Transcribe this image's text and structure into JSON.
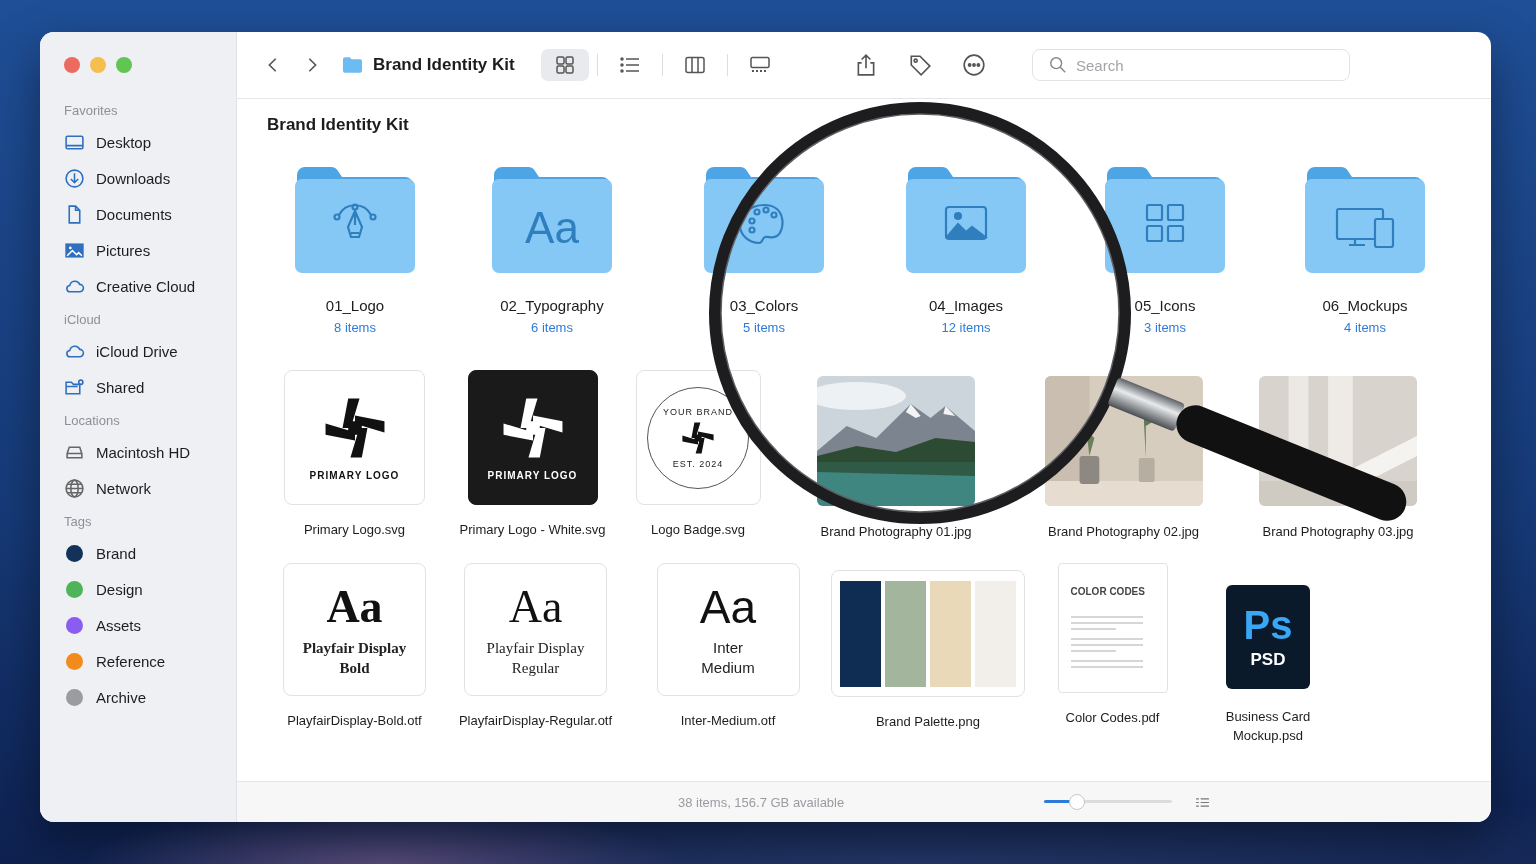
{
  "toolbar": {
    "title": "Brand Identity Kit",
    "views": [
      {
        "kind": "icons",
        "selected": true
      },
      {
        "kind": "list",
        "selected": false
      },
      {
        "kind": "columns",
        "selected": false
      },
      {
        "kind": "gallery",
        "selected": false
      }
    ],
    "actions": [
      {
        "kind": "share"
      },
      {
        "kind": "tag"
      },
      {
        "kind": "more"
      }
    ],
    "search": {
      "placeholder": "Search"
    }
  },
  "sidebar": {
    "sections": [
      {
        "heading": "Favorites",
        "kind": "places",
        "items": [
          {
            "label": "Desktop"
          },
          {
            "label": "Downloads"
          },
          {
            "label": "Documents"
          },
          {
            "label": "Pictures"
          },
          {
            "label": "Creative Cloud"
          }
        ]
      },
      {
        "heading": "iCloud",
        "kind": "places",
        "items": [
          {
            "label": "iCloud Drive"
          },
          {
            "label": "Shared"
          }
        ]
      },
      {
        "heading": "Locations",
        "kind": "places",
        "items": [
          {
            "label": "Macintosh HD"
          },
          {
            "label": "Network"
          }
        ]
      },
      {
        "heading": "Tags",
        "kind": "tags",
        "items": [
          {
            "label": "Brand",
            "color": "#12325a"
          },
          {
            "label": "Design",
            "color": "#4fb35a"
          },
          {
            "label": "Assets",
            "color": "#8b5cf0"
          },
          {
            "label": "Reference",
            "color": "#f28a1c"
          },
          {
            "label": "Archive",
            "color": "#9b9ca0"
          }
        ]
      }
    ]
  },
  "content": {
    "heading": "Brand Identity Kit",
    "folders": [
      {
        "name": "01_Logo",
        "count": "8 items"
      },
      {
        "name": "02_Typography",
        "count": "6 items",
        "glyph": "Aa"
      },
      {
        "name": "03_Colors",
        "count": "5 items"
      },
      {
        "name": "04_Images",
        "count": "12 items"
      },
      {
        "name": "05_Icons",
        "count": "3 items"
      },
      {
        "name": "06_Mockups",
        "count": "4 items"
      }
    ],
    "files": [
      {
        "name": "Primary Logo.svg",
        "kind": "logo",
        "caption": "PRIMARY LOGO"
      },
      {
        "name": "Primary Logo - White.svg",
        "kind": "logo",
        "caption": "PRIMARY LOGO"
      },
      {
        "name": "Logo Badge.svg",
        "kind": "badge",
        "top": "YOUR BRAND",
        "bottom": "EST. 2024"
      },
      {
        "name": "Brand Photography 01.jpg"
      },
      {
        "name": "Brand Photography 02.jpg"
      },
      {
        "name": "Brand Photography 03.jpg"
      },
      {
        "name": "PlayfairDisplay-Bold.otf",
        "kind": "font",
        "sample": "Aa",
        "lines": [
          "Playfair Display",
          "Bold"
        ]
      },
      {
        "name": "PlayfairDisplay-Regular.otf",
        "kind": "font",
        "sample": "Aa",
        "lines": [
          "Playfair Display",
          "Regular"
        ]
      },
      {
        "name": "Inter-Medium.otf",
        "kind": "font",
        "sample": "Aa",
        "lines": [
          "Inter",
          "Medium"
        ]
      },
      {
        "name": "Brand Palette.png",
        "kind": "palette",
        "swatches": [
          {
            "color": "#0f2d52"
          },
          {
            "color": "#a3b59c"
          },
          {
            "color": "#e9d9b9"
          },
          {
            "color": "#f2efeb"
          }
        ]
      },
      {
        "name": "Color Codes.pdf",
        "kind": "document",
        "header": "COLOR CODES"
      },
      {
        "name": "Business Card Mockup.psd",
        "kind": "psd",
        "glyph": "Ps",
        "label": "PSD"
      }
    ]
  },
  "status_bar": {
    "text": "38 items, 156.7 GB available",
    "zoom": {
      "level": 0.23
    }
  }
}
